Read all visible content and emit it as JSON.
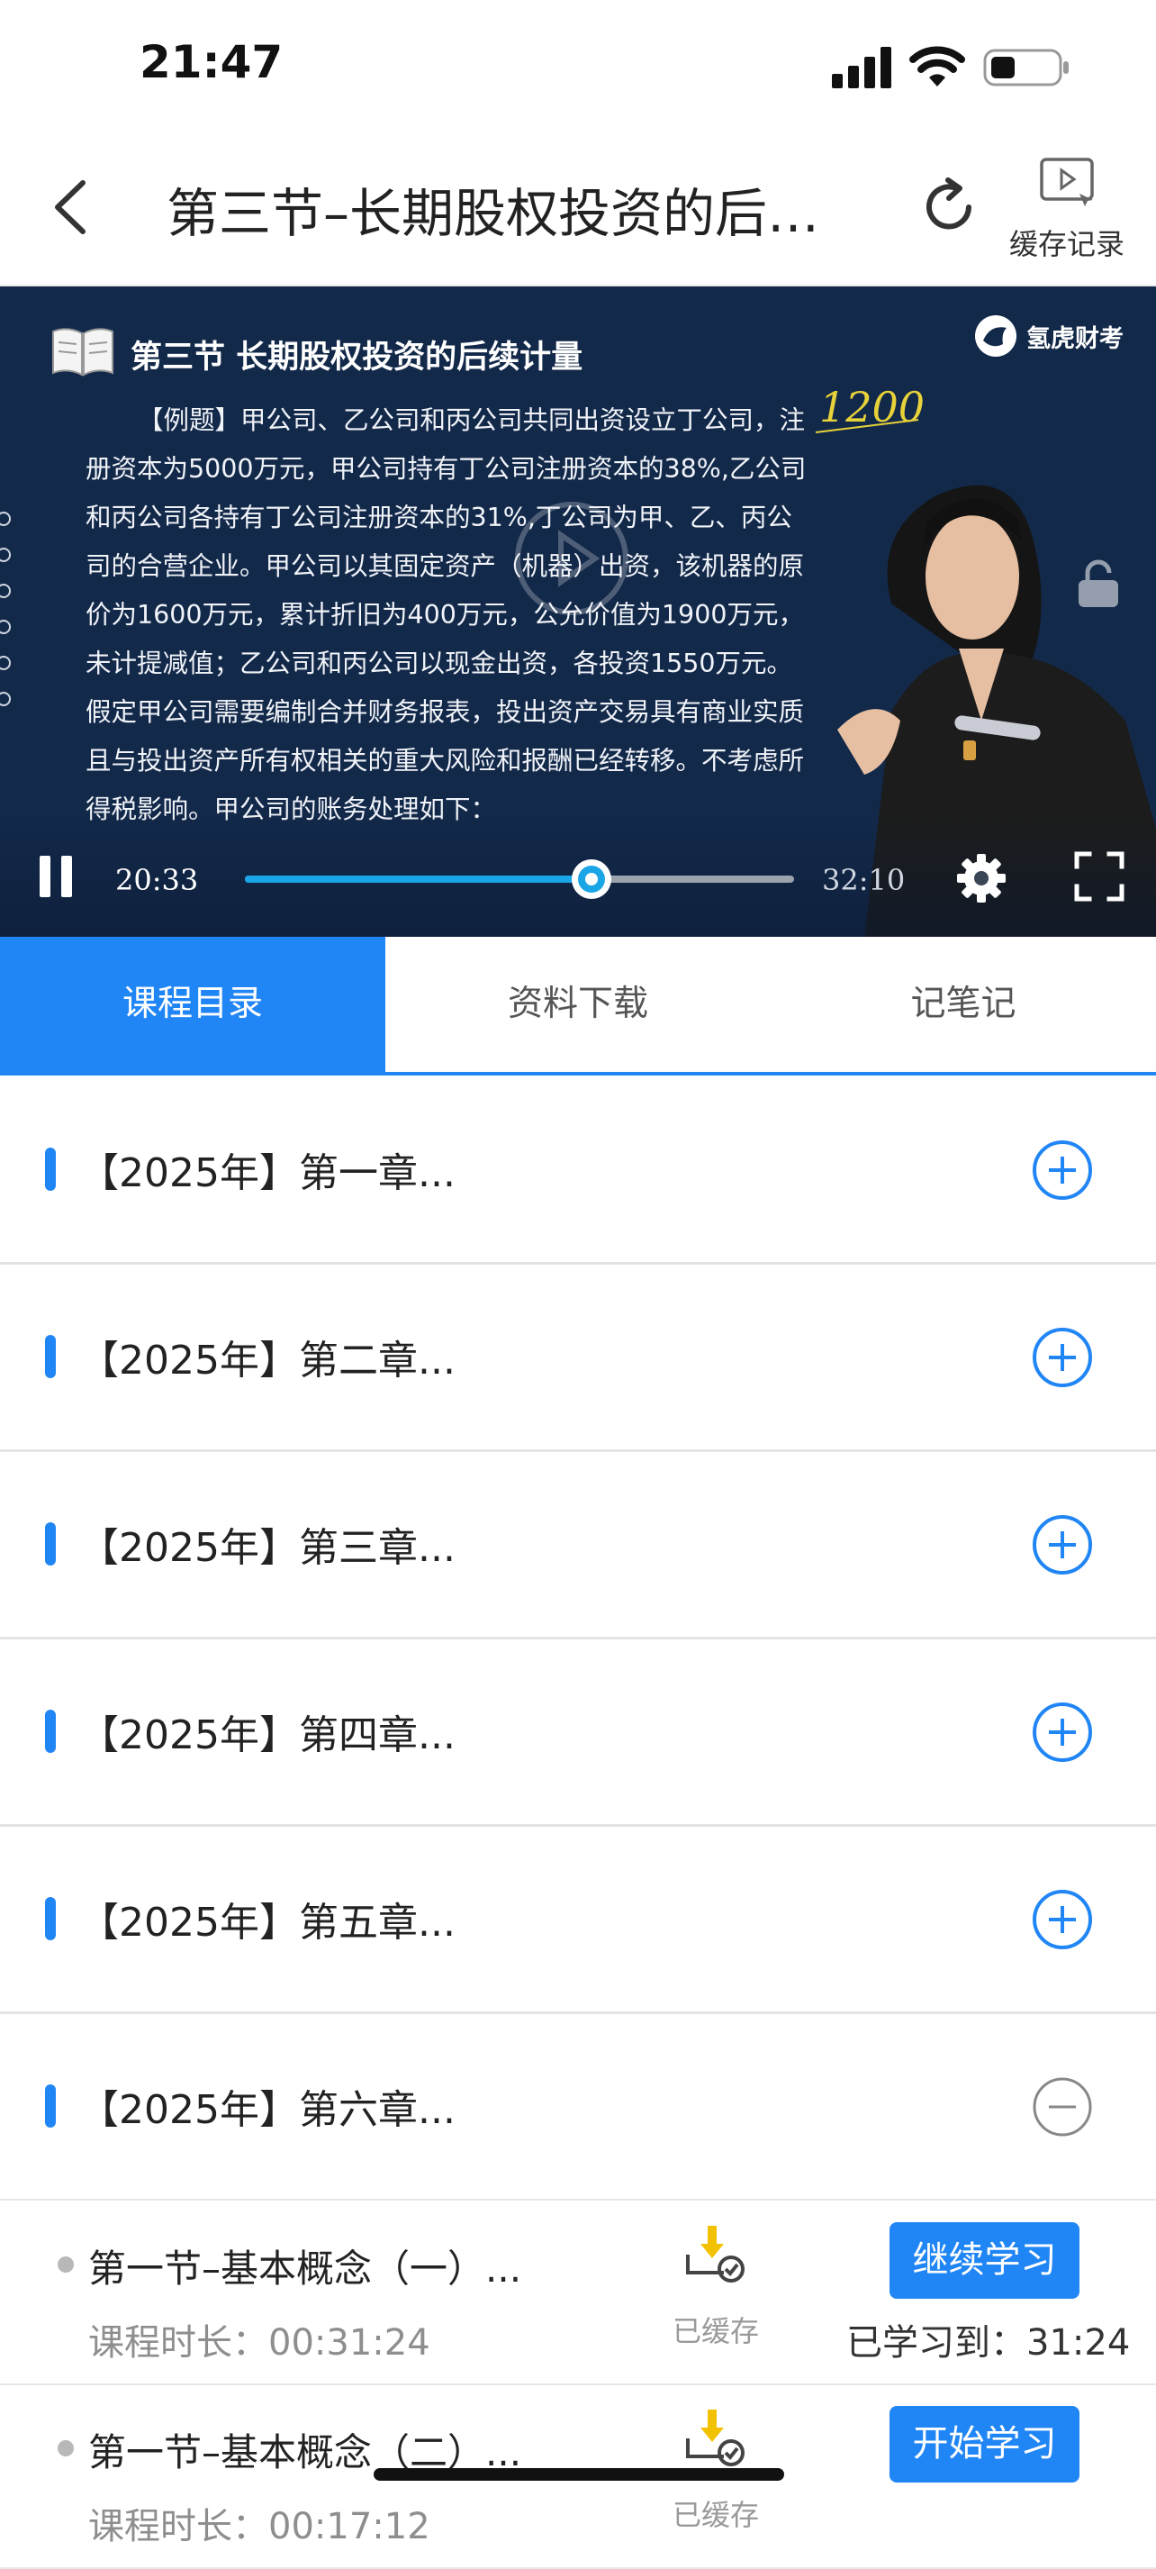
{
  "status_bar": {
    "time": "21:47"
  },
  "header": {
    "title": "第三节–长期股权投资的后…",
    "cache_record_label": "缓存记录"
  },
  "video": {
    "slide_title": "第三节 长期股权投资的后续计量",
    "logo_text": "氢虎财考",
    "slide_body": "【例题】甲公司、乙公司和丙公司共同出资设立丁公司，注册资本为5000万元，甲公司持有丁公司注册资本的38%,乙公司和丙公司各持有丁公司注册资本的31%,丁公司为甲、乙、丙公司的合营企业。甲公司以其固定资产（机器）出资，该机器的原价为1600万元，累计折旧为400万元，公允价值为1900万元，未计提减值；乙公司和丙公司以现金出资，各投资1550万元。假定甲公司需要编制合并财务报表，投出资产交易具有商业实质且与投出资产所有权相关的重大风险和报酬已经转移。不考虑所得税影响。甲公司的账务处理如下：",
    "annotation": "1200",
    "current_time": "20:33",
    "total_time": "32:10",
    "progress_fraction": 0.64
  },
  "tabs": [
    {
      "label": "课程目录",
      "active": true
    },
    {
      "label": "资料下载",
      "active": false
    },
    {
      "label": "记笔记",
      "active": false
    }
  ],
  "chapters": [
    {
      "label": "【2025年】第一章...",
      "expanded": false
    },
    {
      "label": "【2025年】第二章...",
      "expanded": false
    },
    {
      "label": "【2025年】第三章...",
      "expanded": false
    },
    {
      "label": "【2025年】第四章...",
      "expanded": false
    },
    {
      "label": "【2025年】第五章...",
      "expanded": false
    },
    {
      "label": "【2025年】第六章...",
      "expanded": true
    }
  ],
  "lessons": [
    {
      "name": "第一节–基本概念（一）...",
      "duration": "课程时长：00:31:24",
      "cache_status": "已缓存",
      "button": "继续学习",
      "studied": "已学习到：31:24"
    },
    {
      "name": "第一节–基本概念（二）...",
      "duration": "课程时长：00:17:12",
      "cache_status": "已缓存",
      "button": "开始学习",
      "studied": ""
    }
  ],
  "colors": {
    "accent": "#2186f5",
    "video_bg": "#13294a",
    "progress": "#1aa6e6"
  }
}
